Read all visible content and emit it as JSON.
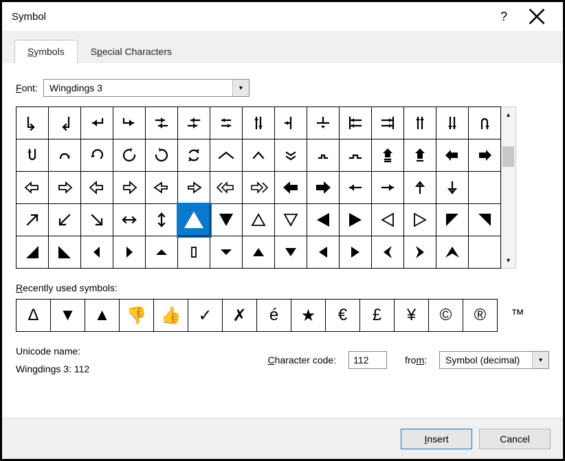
{
  "title": "Symbol",
  "tabs": {
    "symbols": "Symbols",
    "special": "Special Characters"
  },
  "font": {
    "label": "Font:",
    "value": "Wingdings 3"
  },
  "grid": [
    [
      "d-right-arrow-hook",
      "d-left-arrow-hook",
      "return-left",
      "return-right",
      "swap-over",
      "swap-under",
      "exchange",
      "up-down",
      "branch-left",
      "branch-down",
      "left-tab",
      "right-tab",
      "double-up",
      "double-down",
      "u-turn-down"
    ],
    [
      "u-turn-up",
      "redo-small",
      "undo",
      "rotate-ccw",
      "rotate-cw",
      "refresh",
      "chevron-up-wide",
      "chevron-up",
      "chevron-down-thin",
      "bracket-low",
      "bracket-low-2",
      "up-house",
      "up-house-2",
      "left-arrow-open",
      "right-arrow-open"
    ],
    [
      "left-arrow-hollow",
      "right-arrow-hollow",
      "left-arrow-hollow-2",
      "right-arrow-hollow-2",
      "left-arrow-hollow-3",
      "right-arrow-hollow-3",
      "left-arrow-twin",
      "right-arrow-twin",
      "left-arrow-bold",
      "right-arrow-bold",
      "arrow-left-thin",
      "arrow-right-thin",
      "arrow-up-thin",
      "arrow-down-thin",
      ""
    ],
    [
      "arrow-ne",
      "arrow-sw",
      "arrow-se",
      "arrow-lr",
      "arrow-ud",
      "triangle-up-filled",
      "triangle-down-filled",
      "triangle-up-outline",
      "triangle-down-outline",
      "triangle-left-filled",
      "triangle-right-filled",
      "triangle-left-outline",
      "triangle-right-outline",
      "corner-tr",
      "corner-tl"
    ],
    [
      "corner-bl",
      "corner-br",
      "caret-left",
      "caret-right",
      "caret-up-sm",
      "rect-outline",
      "caret-down-sm",
      "tri-up-sm",
      "tri-down-sm",
      "tri-left-sm",
      "tri-right-sm",
      "angle-left",
      "angle-right",
      "chevron-up-bold",
      ""
    ]
  ],
  "selected": {
    "row": 3,
    "col": 5
  },
  "recent_label": "Recently used symbols:",
  "recent": [
    {
      "id": "delta",
      "glyph": "Δ"
    },
    {
      "id": "triangle-down",
      "glyph": "▼"
    },
    {
      "id": "triangle-up",
      "glyph": "▲"
    },
    {
      "id": "thumbs-down",
      "glyph": "👎"
    },
    {
      "id": "thumbs-up",
      "glyph": "👍"
    },
    {
      "id": "check",
      "glyph": "✓"
    },
    {
      "id": "cross",
      "glyph": "✗"
    },
    {
      "id": "e-acute",
      "glyph": "é"
    },
    {
      "id": "star",
      "glyph": "★"
    },
    {
      "id": "euro",
      "glyph": "€"
    },
    {
      "id": "pound",
      "glyph": "£"
    },
    {
      "id": "yen",
      "glyph": "¥"
    },
    {
      "id": "copyright",
      "glyph": "©"
    },
    {
      "id": "registered",
      "glyph": "®"
    }
  ],
  "recent_overflow": {
    "id": "trademark",
    "glyph": "™"
  },
  "unicode_name_label": "Unicode name:",
  "unicode_name": "Wingdings 3: 112",
  "charcode_label": "Character code:",
  "charcode_value": "112",
  "from_label": "from:",
  "from_value": "Symbol (decimal)",
  "buttons": {
    "insert": "Insert",
    "cancel": "Cancel"
  }
}
